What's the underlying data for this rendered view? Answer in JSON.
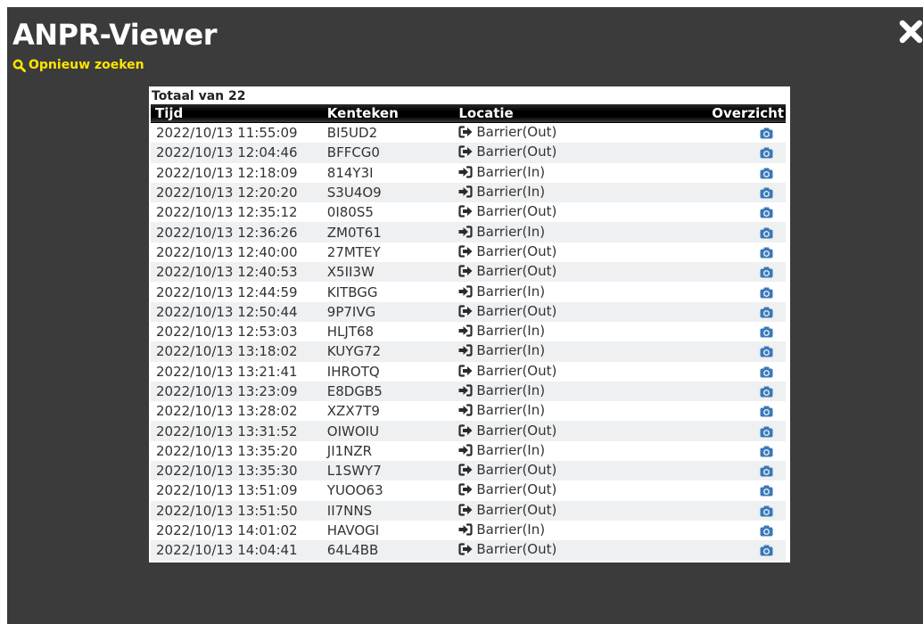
{
  "app": {
    "title": "ANPR-Viewer",
    "search_again_label": "Opnieuw zoeken",
    "search_icon": "search-icon",
    "close_icon": "close-icon"
  },
  "colors": {
    "background": "#3b3b3b",
    "link": "#ffe600",
    "camera": "#3a78b8"
  },
  "results": {
    "total_label": "Totaal van 22",
    "columns": [
      "Tijd",
      "Kenteken",
      "Locatie",
      "Overzicht"
    ],
    "rows": [
      {
        "time": "2022/10/13 11:55:09",
        "plate": "BI5UD2",
        "location": "Barrier(Out)",
        "direction": "out"
      },
      {
        "time": "2022/10/13 12:04:46",
        "plate": "BFFCG0",
        "location": "Barrier(Out)",
        "direction": "out"
      },
      {
        "time": "2022/10/13 12:18:09",
        "plate": "814Y3I",
        "location": "Barrier(In)",
        "direction": "in"
      },
      {
        "time": "2022/10/13 12:20:20",
        "plate": "S3U4O9",
        "location": "Barrier(In)",
        "direction": "in"
      },
      {
        "time": "2022/10/13 12:35:12",
        "plate": "0I80S5",
        "location": "Barrier(Out)",
        "direction": "out"
      },
      {
        "time": "2022/10/13 12:36:26",
        "plate": "ZM0T61",
        "location": "Barrier(In)",
        "direction": "in"
      },
      {
        "time": "2022/10/13 12:40:00",
        "plate": "27MTEY",
        "location": "Barrier(Out)",
        "direction": "out"
      },
      {
        "time": "2022/10/13 12:40:53",
        "plate": "X5II3W",
        "location": "Barrier(Out)",
        "direction": "out"
      },
      {
        "time": "2022/10/13 12:44:59",
        "plate": "KITBGG",
        "location": "Barrier(In)",
        "direction": "in"
      },
      {
        "time": "2022/10/13 12:50:44",
        "plate": "9P7IVG",
        "location": "Barrier(Out)",
        "direction": "out"
      },
      {
        "time": "2022/10/13 12:53:03",
        "plate": "HLJT68",
        "location": "Barrier(In)",
        "direction": "in"
      },
      {
        "time": "2022/10/13 13:18:02",
        "plate": "KUYG72",
        "location": "Barrier(In)",
        "direction": "in"
      },
      {
        "time": "2022/10/13 13:21:41",
        "plate": "IHROTQ",
        "location": "Barrier(Out)",
        "direction": "out"
      },
      {
        "time": "2022/10/13 13:23:09",
        "plate": "E8DGB5",
        "location": "Barrier(In)",
        "direction": "in"
      },
      {
        "time": "2022/10/13 13:28:02",
        "plate": "XZX7T9",
        "location": "Barrier(In)",
        "direction": "in"
      },
      {
        "time": "2022/10/13 13:31:52",
        "plate": "OIWOIU",
        "location": "Barrier(Out)",
        "direction": "out"
      },
      {
        "time": "2022/10/13 13:35:20",
        "plate": "JI1NZR",
        "location": "Barrier(In)",
        "direction": "in"
      },
      {
        "time": "2022/10/13 13:35:30",
        "plate": "L1SWY7",
        "location": "Barrier(Out)",
        "direction": "out"
      },
      {
        "time": "2022/10/13 13:51:09",
        "plate": "YUOO63",
        "location": "Barrier(Out)",
        "direction": "out"
      },
      {
        "time": "2022/10/13 13:51:50",
        "plate": "II7NNS",
        "location": "Barrier(Out)",
        "direction": "out"
      },
      {
        "time": "2022/10/13 14:01:02",
        "plate": "HAVOGI",
        "location": "Barrier(In)",
        "direction": "in"
      },
      {
        "time": "2022/10/13 14:04:41",
        "plate": "64L4BB",
        "location": "Barrier(Out)",
        "direction": "out"
      }
    ]
  }
}
